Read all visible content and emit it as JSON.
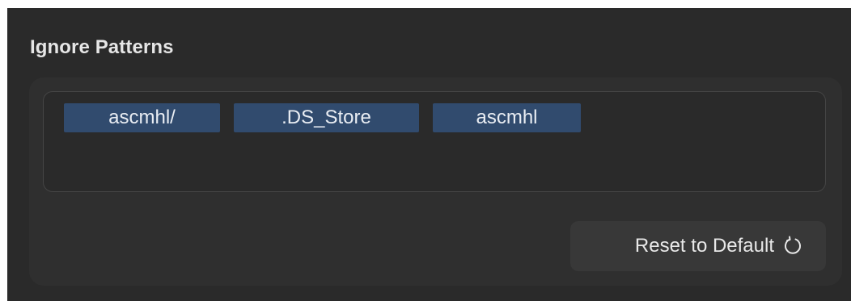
{
  "section": {
    "title": "Ignore Patterns"
  },
  "patterns": [
    {
      "label": "ascmhl/"
    },
    {
      "label": ".DS_Store"
    },
    {
      "label": "ascmhl"
    }
  ],
  "reset_button": {
    "label": "Reset to Default",
    "icon": "reset-arrow-icon"
  },
  "colors": {
    "background": "#2a2a2a",
    "panel": "#2f2f2f",
    "token_background": "#314b6e",
    "button_background": "#383838"
  }
}
